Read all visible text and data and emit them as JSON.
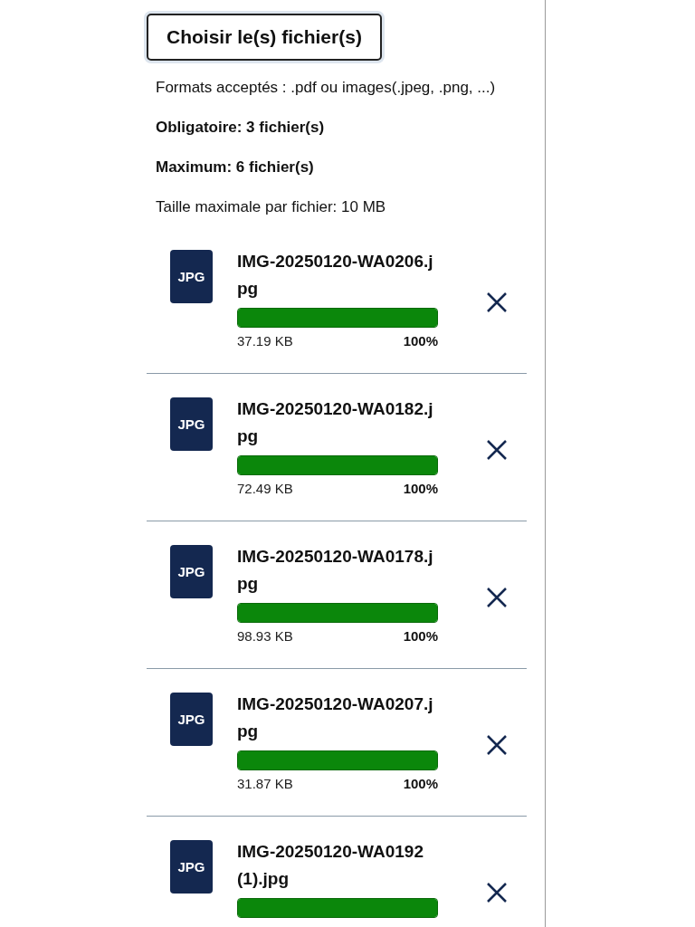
{
  "upload_button": "Choisir le(s) fichier(s)",
  "info": [
    {
      "text": "Formats acceptés : .pdf ou images(.jpeg, .png, ...)",
      "kind": "normal"
    },
    {
      "text": "Obligatoire: 3 fichier(s)",
      "kind": "bold"
    },
    {
      "text": "Maximum: 6 fichier(s)",
      "kind": "bold"
    },
    {
      "text": "Taille maximale par fichier: 10 MB",
      "kind": "normal"
    }
  ],
  "files": [
    {
      "type": "JPG",
      "name": "IMG-20250120-WA0206.jpg",
      "level": 1,
      "size": "37.19 KB",
      "percent": "100%"
    },
    {
      "type": "JPG",
      "name": "IMG-20250120-WA0182.jpg",
      "level": 1,
      "size": "72.49 KB",
      "percent": "100%"
    },
    {
      "type": "JPG",
      "name": "IMG-20250120-WA0178.jpg",
      "level": 1,
      "size": "98.93 KB",
      "percent": "100%"
    },
    {
      "type": "JPG",
      "name": "IMG-20250120-WA0207.jpg",
      "level": 1,
      "size": "31.87 KB",
      "percent": "100%"
    },
    {
      "type": "JPG",
      "name": "IMG-20250120-WA0192(1).jpg",
      "level": 1
    }
  ]
}
